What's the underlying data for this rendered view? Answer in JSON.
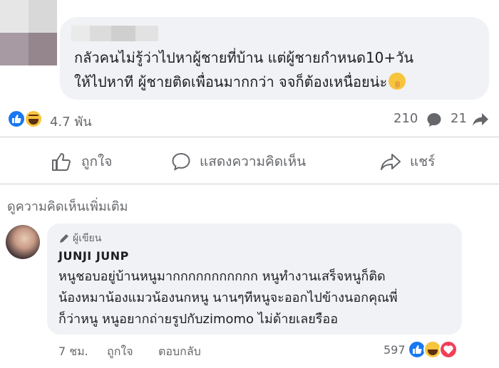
{
  "post": {
    "text_line1": "กลัวคนไม่รู้ว่าไปหาผู้ชายที่บ้าน แต่ผู้ชายกำหนด10+วัน",
    "text_line2": "ให้ไปหาที ผู้ชายติดเพื่อนมากกว่า จจก็ต้องเหนื่อยน่ะ"
  },
  "stats": {
    "reactions": "4.7 พัน",
    "comments": "210",
    "shares": "21"
  },
  "actions": {
    "like": "ถูกใจ",
    "comment": "แสดงความคิดเห็น",
    "share": "แชร์"
  },
  "more_comments": "ดูความคิดเห็นเพิ่มเติม",
  "comment": {
    "badge": "ผู้เขียน",
    "author": "JUNJI JUNP",
    "line1": "หนูชอบอยู่บ้านหนูมากกกกกกกกกกก หนูทำงานเสร็จหนูก็ติด",
    "line2": "น้องหมาน้องแมวน้องนกหนู นานๆทีหนูจะออกไปข้างนอกคุณพี่",
    "line3": "ก็ว่าหนู หนูอยากถ่ายรูปกับzimomo ไม่ด้ายเลยรืออ",
    "time": "7 ชม.",
    "like": "ถูกใจ",
    "reply": "ตอบกลับ",
    "reaction_count": "597"
  },
  "icons": {
    "reactions": [
      "like-icon",
      "haha-icon",
      "love-icon"
    ],
    "actions": [
      "thumbs-up-icon",
      "comment-icon",
      "share-icon"
    ]
  },
  "colors": {
    "accent": "#1877f2",
    "bubble": "#f0f2f5",
    "muted": "#65676b"
  }
}
